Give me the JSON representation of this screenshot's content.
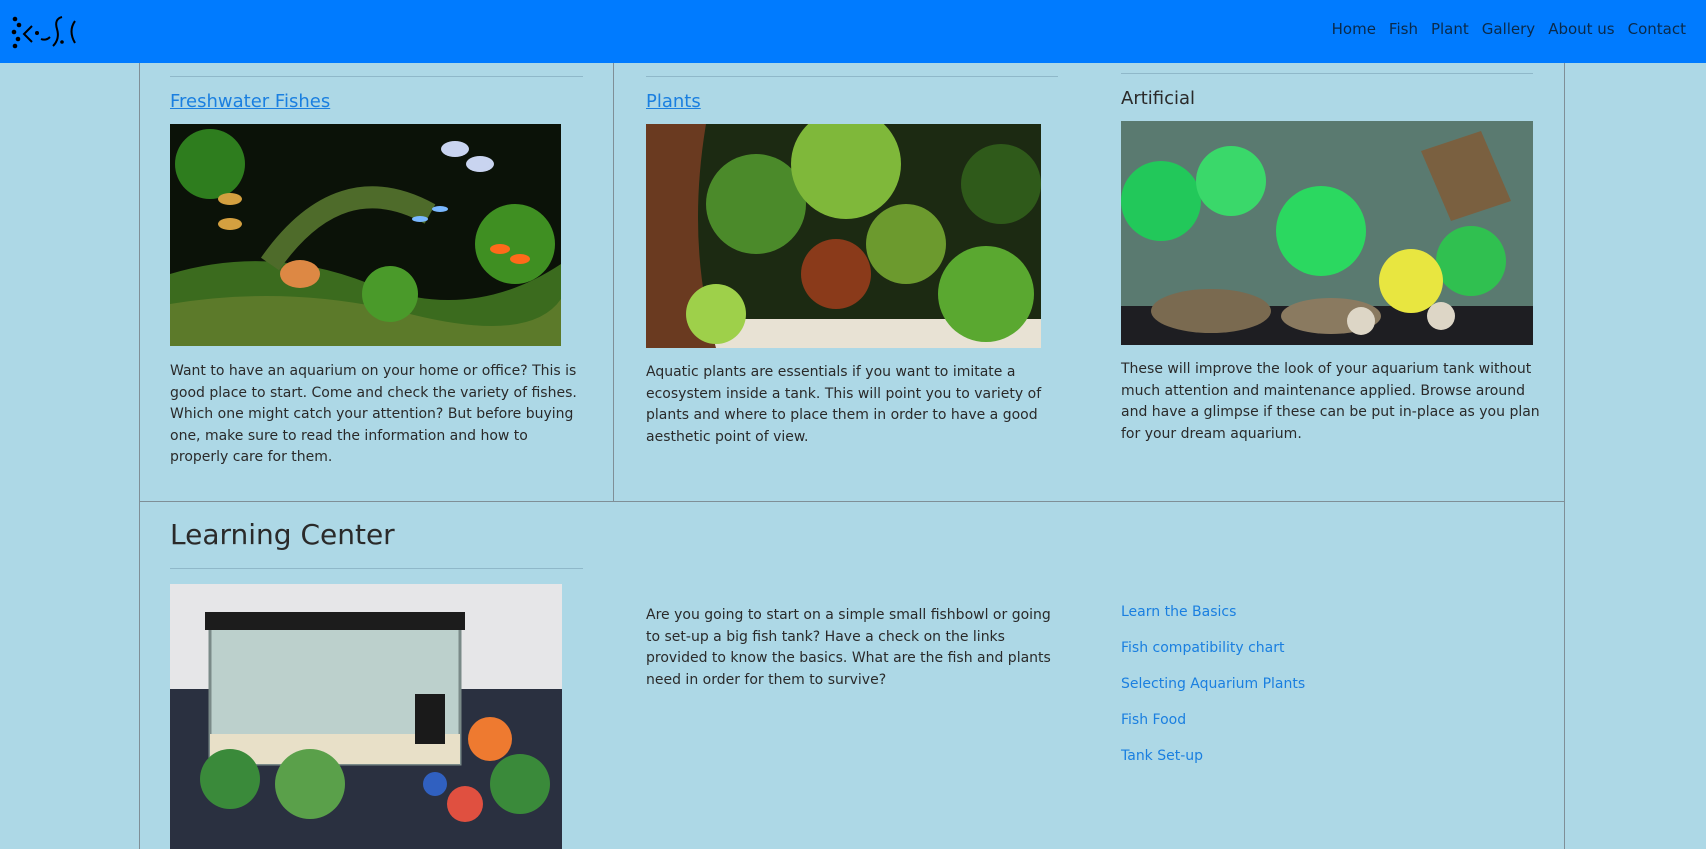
{
  "nav": {
    "links": [
      "Home",
      "Fish",
      "Plant",
      "Gallery",
      "About us",
      "Contact"
    ]
  },
  "cards": [
    {
      "title": "Freshwater Fishes",
      "text": "Want to have an aquarium on your home or office? This is good place to start. Come and check the variety of fishes. Which one might catch your attention? But before buying one, make sure to read the information and how to properly care for them."
    },
    {
      "title": "Plants",
      "text": "Aquatic plants are essentials if you want to imitate a ecosystem inside a tank. This will point you to variety of plants and where to place them in order to have a good aesthetic point of view."
    },
    {
      "title": "Artificial",
      "text": "These will improve the look of your aquarium tank without much attention and maintenance applied. Browse around and have a glimpse if these can be put in-place as you plan for your dream aquarium."
    }
  ],
  "learning": {
    "title": "Learning Center",
    "text": "Are you going to start on a simple small fishbowl or going to set-up a big fish tank? Have a check on the links provided to know the basics. What are the fish and plants need in order for them to survive?",
    "links": [
      "Learn the Basics",
      "Fish compatibility chart",
      "Selecting Aquarium Plants",
      "Fish Food",
      "Tank Set-up"
    ]
  },
  "colors": {
    "navbar": "#007bff",
    "background": "#add8e6",
    "link": "#1a7fe0"
  }
}
